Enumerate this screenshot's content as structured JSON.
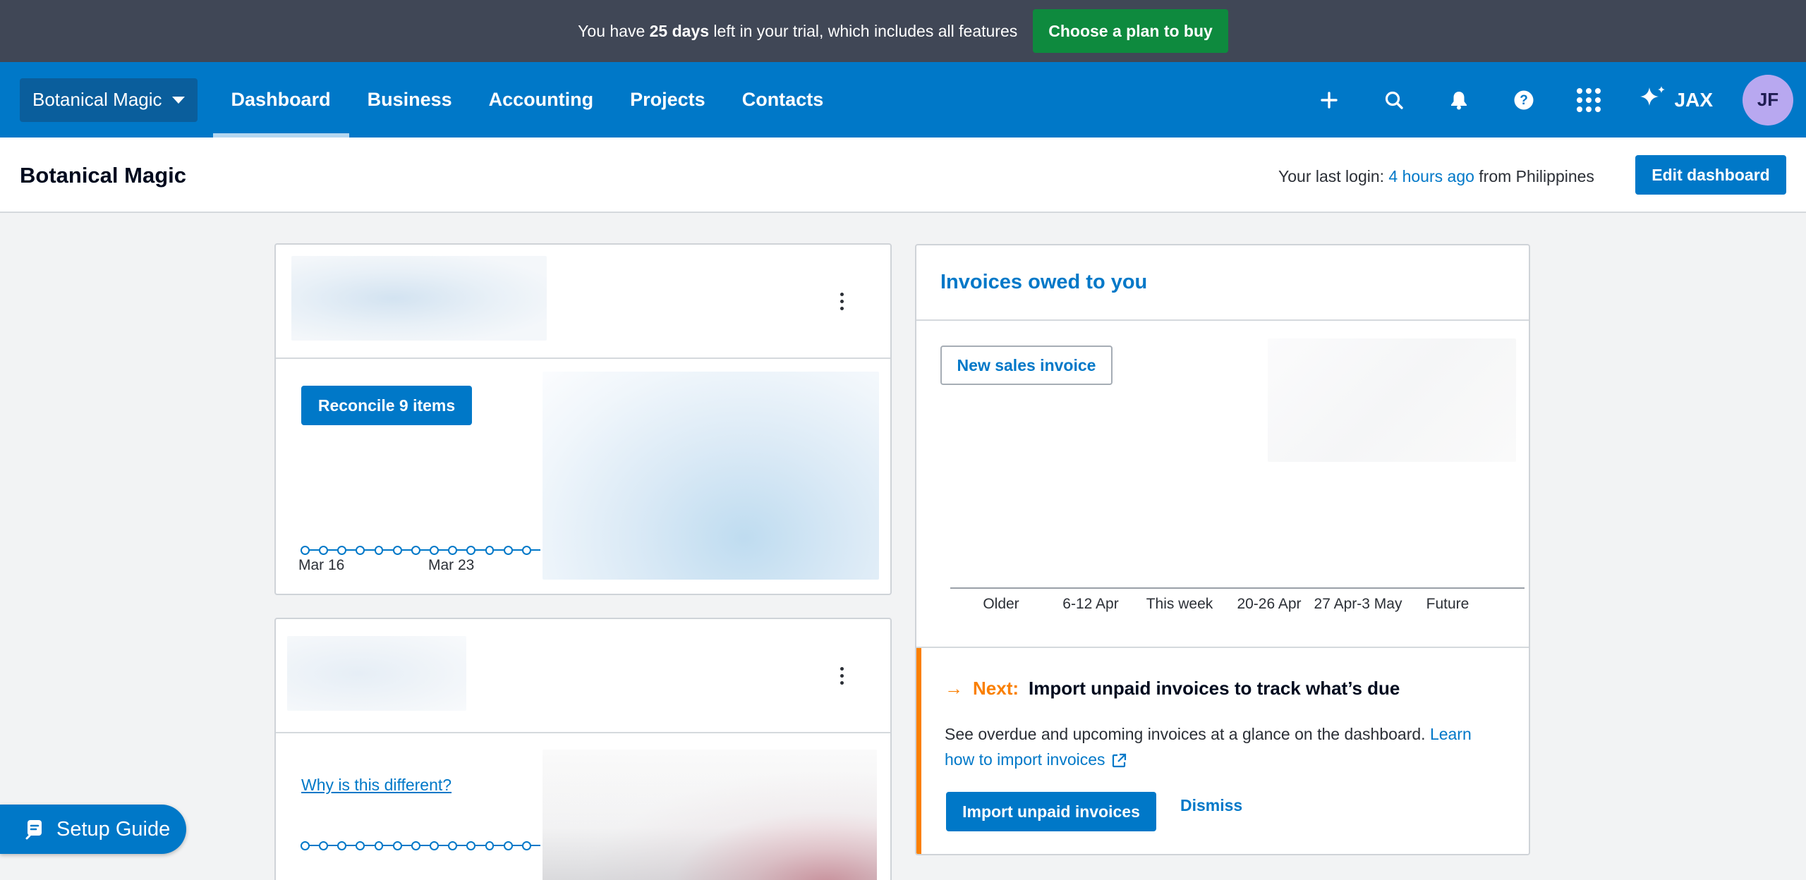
{
  "trial_banner": {
    "prefix": "You have ",
    "days": "25 days",
    "suffix": " left in your trial, which includes all features",
    "cta": "Choose a plan to buy"
  },
  "nav": {
    "org_switcher": "Botanical Magic",
    "tabs": [
      {
        "label": "Dashboard",
        "active": true
      },
      {
        "label": "Business"
      },
      {
        "label": "Accounting"
      },
      {
        "label": "Projects"
      },
      {
        "label": "Contacts"
      }
    ],
    "icons": [
      "plus-icon",
      "search-icon",
      "bell-icon",
      "help-icon",
      "apps-grid-icon"
    ],
    "jax_label": "JAX",
    "avatar_initials": "JF"
  },
  "header": {
    "org_name": "Botanical Magic",
    "last_login_prefix": "Your last login: ",
    "last_login_link": "4 hours ago",
    "last_login_suffix": " from Philippines",
    "edit_button": "Edit dashboard"
  },
  "bank_card": {
    "reconcile_button": "Reconcile 9 items",
    "axis_labels": [
      "Mar 16",
      "Mar 23"
    ]
  },
  "second_card": {
    "why_link": "Why is this different?"
  },
  "invoices": {
    "title": "Invoices owed to you",
    "new_button": "New sales invoice",
    "categories": [
      "Older",
      "6-12 Apr",
      "This week",
      "20-26 Apr",
      "27 Apr-3 May",
      "Future"
    ],
    "next": {
      "label": "Next:",
      "title": "Import unpaid invoices to track what’s due",
      "body": "See overdue and upcoming invoices at a glance on the dashboard. ",
      "link": "Learn how to import invoices",
      "primary_button": "Import unpaid invoices",
      "dismiss": "Dismiss"
    }
  },
  "setup_guide": "Setup Guide",
  "colors": {
    "brand_blue": "#0078c8",
    "banner_bg": "#404756",
    "buy_green": "#0e8a3e",
    "next_orange": "#fa7f00"
  }
}
